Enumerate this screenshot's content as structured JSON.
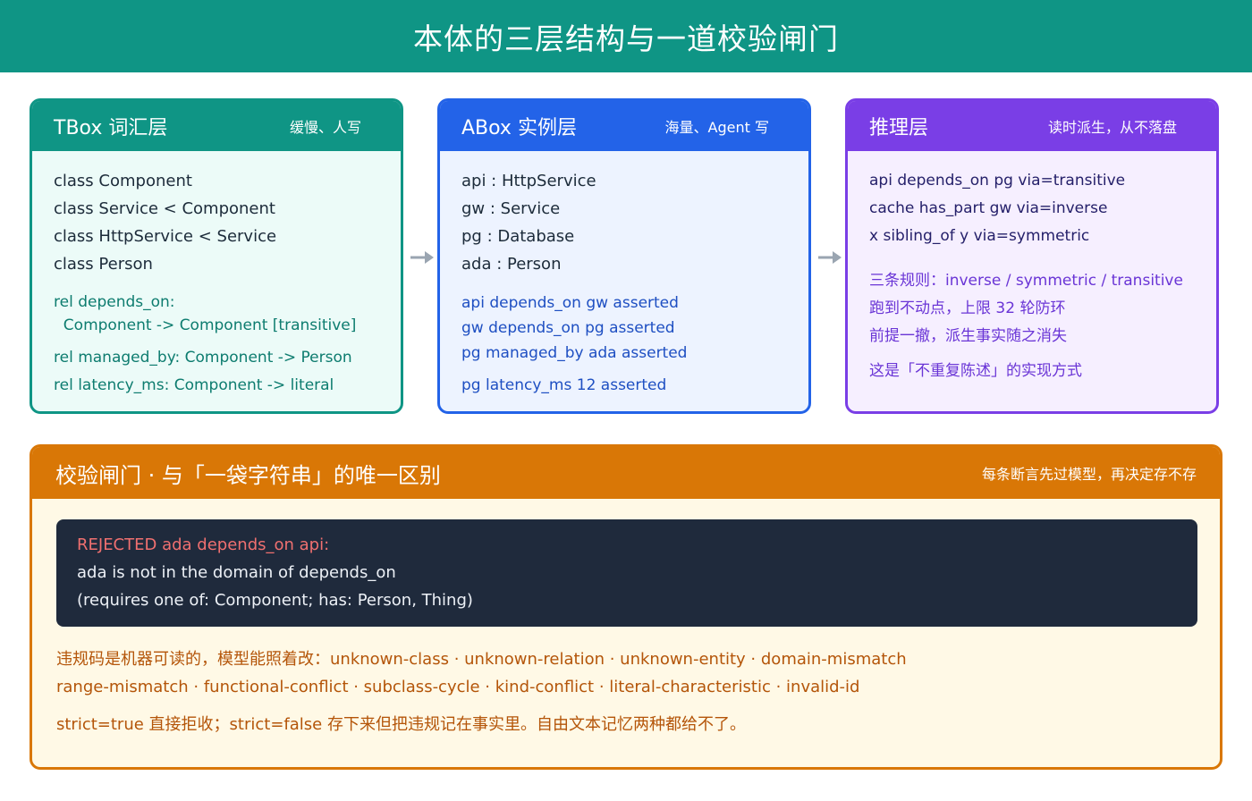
{
  "page_title": "本体的三层结构与一道校验闸门",
  "tbox": {
    "title": "TBox 词汇层",
    "note": "缓慢、人写",
    "classes": [
      "class Component",
      "class Service < Component",
      "class HttpService < Service",
      "class Person"
    ],
    "rel_depends_1": "rel depends_on:",
    "rel_depends_2": "  Component -> Component [transitive]",
    "rel_managed": "rel managed_by: Component -> Person",
    "rel_latency": "rel latency_ms: Component -> literal"
  },
  "abox": {
    "title": "ABox 实例层",
    "note": "海量、Agent 写",
    "instances": [
      "api : HttpService",
      "gw : Service",
      "pg : Database",
      "ada : Person"
    ],
    "assertions": [
      "api depends_on gw asserted",
      "gw depends_on pg asserted",
      "pg managed_by ada asserted"
    ],
    "literal_assertion": "pg latency_ms 12 asserted"
  },
  "inference": {
    "title": "推理层",
    "note": "读时派生，从不落盘",
    "derived": [
      "api depends_on pg via=transitive",
      "cache has_part gw via=inverse",
      "x sibling_of y via=symmetric"
    ],
    "rules": [
      "三条规则：inverse / symmetric / transitive",
      "跑到不动点，上限 32 轮防环",
      "前提一撤，派生事实随之消失"
    ],
    "summary": "这是「不重复陈述」的实现方式"
  },
  "gate": {
    "title": "校验闸门 · 与「一袋字符串」的唯一区别",
    "note": "每条断言先过模型，再决定存不存",
    "error_line": "REJECTED ada depends_on api:",
    "error_detail_1": "ada is not in the domain of depends_on",
    "error_detail_2": "(requires one of: Component; has: Person, Thing)",
    "codes_line_1": "违规码是机器可读的，模型能照着改：unknown-class · unknown-relation · unknown-entity · domain-mismatch",
    "codes_line_2": "range-mismatch · functional-conflict · subclass-cycle · kind-conflict · literal-characteristic · invalid-id",
    "strict_line": "strict=true 直接拒收；strict=false 存下来但把违规记在事实里。自由文本记忆两种都给不了。"
  },
  "colors": {
    "header": "#0f9585",
    "tbox": "#0f9585",
    "abox": "#2363e8",
    "inference": "#7a3ee6",
    "gate": "#d97706",
    "terminal_bg": "#1f2a3c",
    "error": "#f07070",
    "arrow": "#9aa5b1"
  },
  "icons": {
    "flow_arrow": "right-arrow-icon"
  }
}
